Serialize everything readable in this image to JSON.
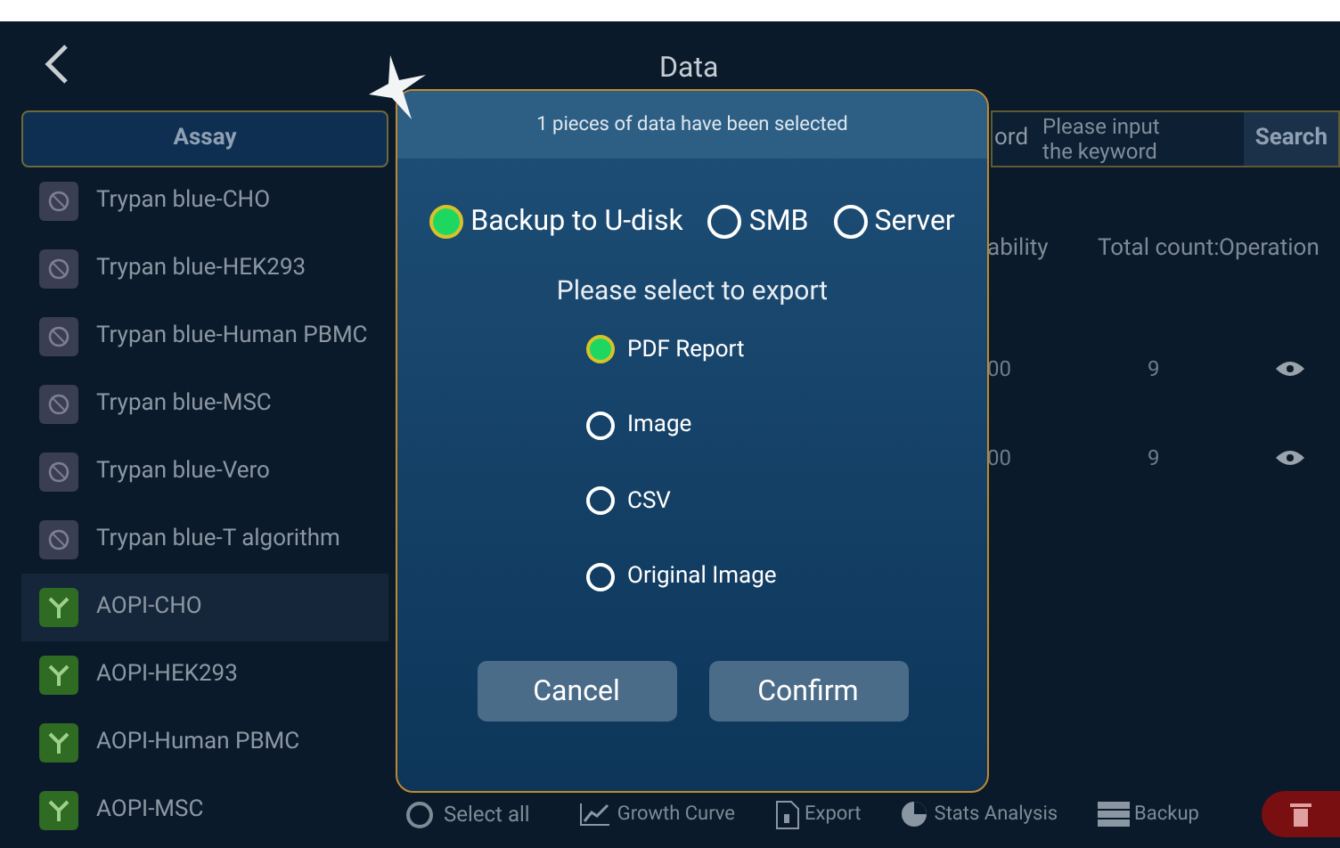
{
  "title": "Data",
  "sidebar": {
    "header": "Assay",
    "items": [
      {
        "label": "Trypan blue-CHO",
        "kind": "trypan",
        "selected": false
      },
      {
        "label": "Trypan blue-HEK293",
        "kind": "trypan",
        "selected": false
      },
      {
        "label": "Trypan blue-Human PBMC",
        "kind": "trypan",
        "selected": false
      },
      {
        "label": "Trypan blue-MSC",
        "kind": "trypan",
        "selected": false
      },
      {
        "label": "Trypan blue-Vero",
        "kind": "trypan",
        "selected": false
      },
      {
        "label": "Trypan blue-T algorithm",
        "kind": "trypan",
        "selected": false
      },
      {
        "label": "AOPI-CHO",
        "kind": "aopi",
        "selected": true
      },
      {
        "label": "AOPI-HEK293",
        "kind": "aopi",
        "selected": false
      },
      {
        "label": "AOPI-Human PBMC",
        "kind": "aopi",
        "selected": false
      },
      {
        "label": "AOPI-MSC",
        "kind": "aopi",
        "selected": false
      }
    ]
  },
  "search": {
    "label": "ord",
    "placeholder": "Please input the keyword",
    "button": "Search"
  },
  "table": {
    "columns": [
      "ability",
      "Total count:",
      "Operation"
    ],
    "rows": [
      {
        "column_1": "00",
        "column_2": "9"
      },
      {
        "column_1": "00",
        "column_2": "9"
      }
    ]
  },
  "bottom_bar": {
    "select_all": {
      "label": "Select all",
      "checked": false
    },
    "actions": [
      {
        "label": "Growth Curve",
        "kind": "curve"
      },
      {
        "label": "Export",
        "kind": "export"
      },
      {
        "label": "Stats Analysis",
        "kind": "pie"
      },
      {
        "label": "Backup",
        "kind": "backup"
      }
    ]
  },
  "dialog": {
    "header": "1 pieces of data have been selected",
    "targets": [
      {
        "label": "Backup to U-disk",
        "selected": true
      },
      {
        "label": "SMB",
        "selected": false
      },
      {
        "label": "Server",
        "selected": false
      }
    ],
    "prompt": "Please select to export",
    "formats": [
      {
        "label": "PDF Report",
        "selected": true
      },
      {
        "label": "Image",
        "selected": false
      },
      {
        "label": "CSV",
        "selected": false
      },
      {
        "label": "Original Image",
        "selected": false
      }
    ],
    "buttons": [
      "Cancel",
      "Confirm"
    ]
  }
}
